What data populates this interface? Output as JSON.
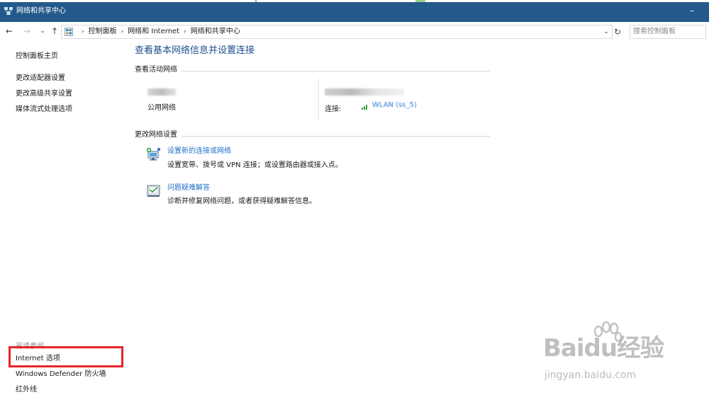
{
  "window": {
    "title": "网络和共享中心",
    "minimize_label": "–"
  },
  "nav": {
    "back": "←",
    "forward": "→",
    "recent": "⌄",
    "up": "↑",
    "refresh": "↻",
    "dropdown": "⌄",
    "breadcrumbs": [
      "控制面板",
      "网络和 Internet",
      "网络和共享中心"
    ],
    "search_placeholder": "搜索控制面板"
  },
  "left_pane": {
    "home_link": "控制面板主页",
    "links": [
      "更改适配器设置",
      "更改高级共享设置",
      "媒体流式处理选项"
    ],
    "see_also_label": "另请参阅",
    "see_also_links": [
      "Internet 选项",
      "Windows Defender 防火墙",
      "红外线"
    ]
  },
  "main": {
    "title": "查看基本网络信息并设置连接",
    "active_networks_heading": "查看活动网络",
    "network_type": "公用网络",
    "connections_label": "连接:",
    "connection_name": "WLAN (ss_5)",
    "change_settings_heading": "更改网络设置",
    "tasks": [
      {
        "link": "设置新的连接或网络",
        "desc": "设置宽带、拨号或 VPN 连接；或设置路由器或接入点。",
        "icon": "new-connection-icon"
      },
      {
        "link": "问题疑难解答",
        "desc": "诊断并修复网络问题，或者获得疑难解答信息。",
        "icon": "troubleshoot-icon"
      }
    ]
  },
  "watermark": {
    "brand": "Baidu经验",
    "url": "jingyan.baidu.com"
  },
  "colors": {
    "titlebar": "#235a8b",
    "link_blue": "#1f6fc5",
    "title_blue": "#1e4e8c",
    "highlight_red": "#e8242b"
  }
}
